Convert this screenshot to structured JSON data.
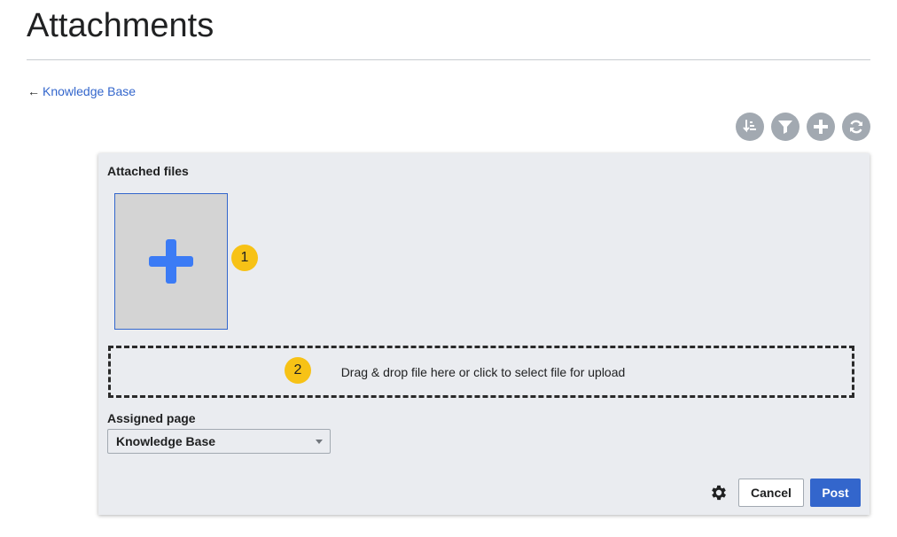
{
  "page": {
    "title": "Attachments",
    "back_arrow": "←",
    "back_link": "Knowledge Base"
  },
  "toolbar": {
    "icons": [
      "sort-icon",
      "filter-icon",
      "add-icon",
      "refresh-icon"
    ],
    "icon_bg": "#a2a9b1"
  },
  "panel": {
    "heading": "Attached files",
    "badge_1": "1",
    "badge_2": "2",
    "dropzone_text": "Drag & drop file here or click to select file for upload",
    "assigned_label": "Assigned page",
    "assigned_value": "Knowledge Base",
    "cancel_label": "Cancel",
    "post_label": "Post"
  },
  "colors": {
    "accent": "#3366cc",
    "badge": "#f7c216",
    "panel_bg": "#eaecf0",
    "plus": "#3b7bf5"
  }
}
